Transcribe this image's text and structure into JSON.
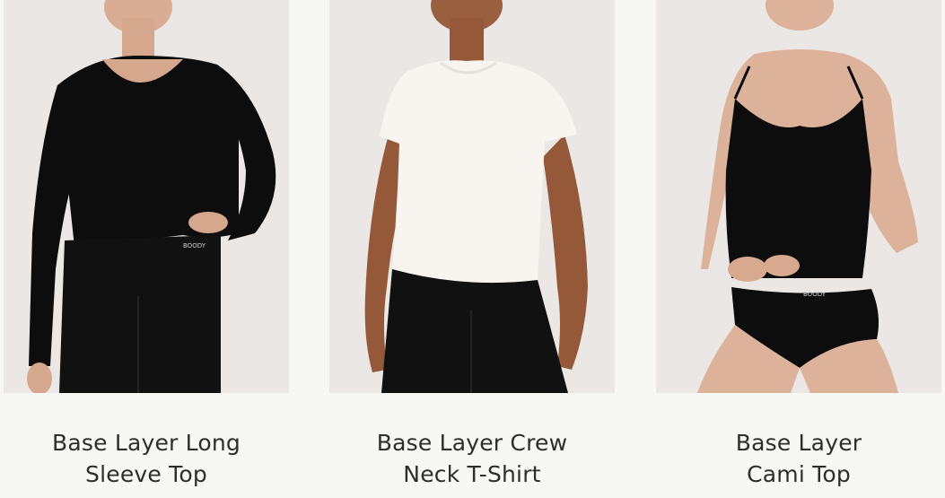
{
  "colors": {
    "page_bg": "#f7f7f3",
    "image_bg": "#ebe7e4",
    "skin": "#dcb39a",
    "garment_black": "#0d0d0d",
    "garment_white": "#f8f5f0",
    "title_text": "#2d2d2d"
  },
  "products": [
    {
      "title_line1": "Base Layer Long",
      "title_line2": "Sleeve Top",
      "brand_mark": "BOODY",
      "garment": "long-sleeve-black"
    },
    {
      "title_line1": "Base Layer Crew",
      "title_line2": "Neck T-Shirt",
      "garment": "crew-tee-white"
    },
    {
      "title_line1": "Base Layer",
      "title_line2": "Cami Top",
      "brand_mark": "BOODY",
      "garment": "cami-black"
    }
  ]
}
